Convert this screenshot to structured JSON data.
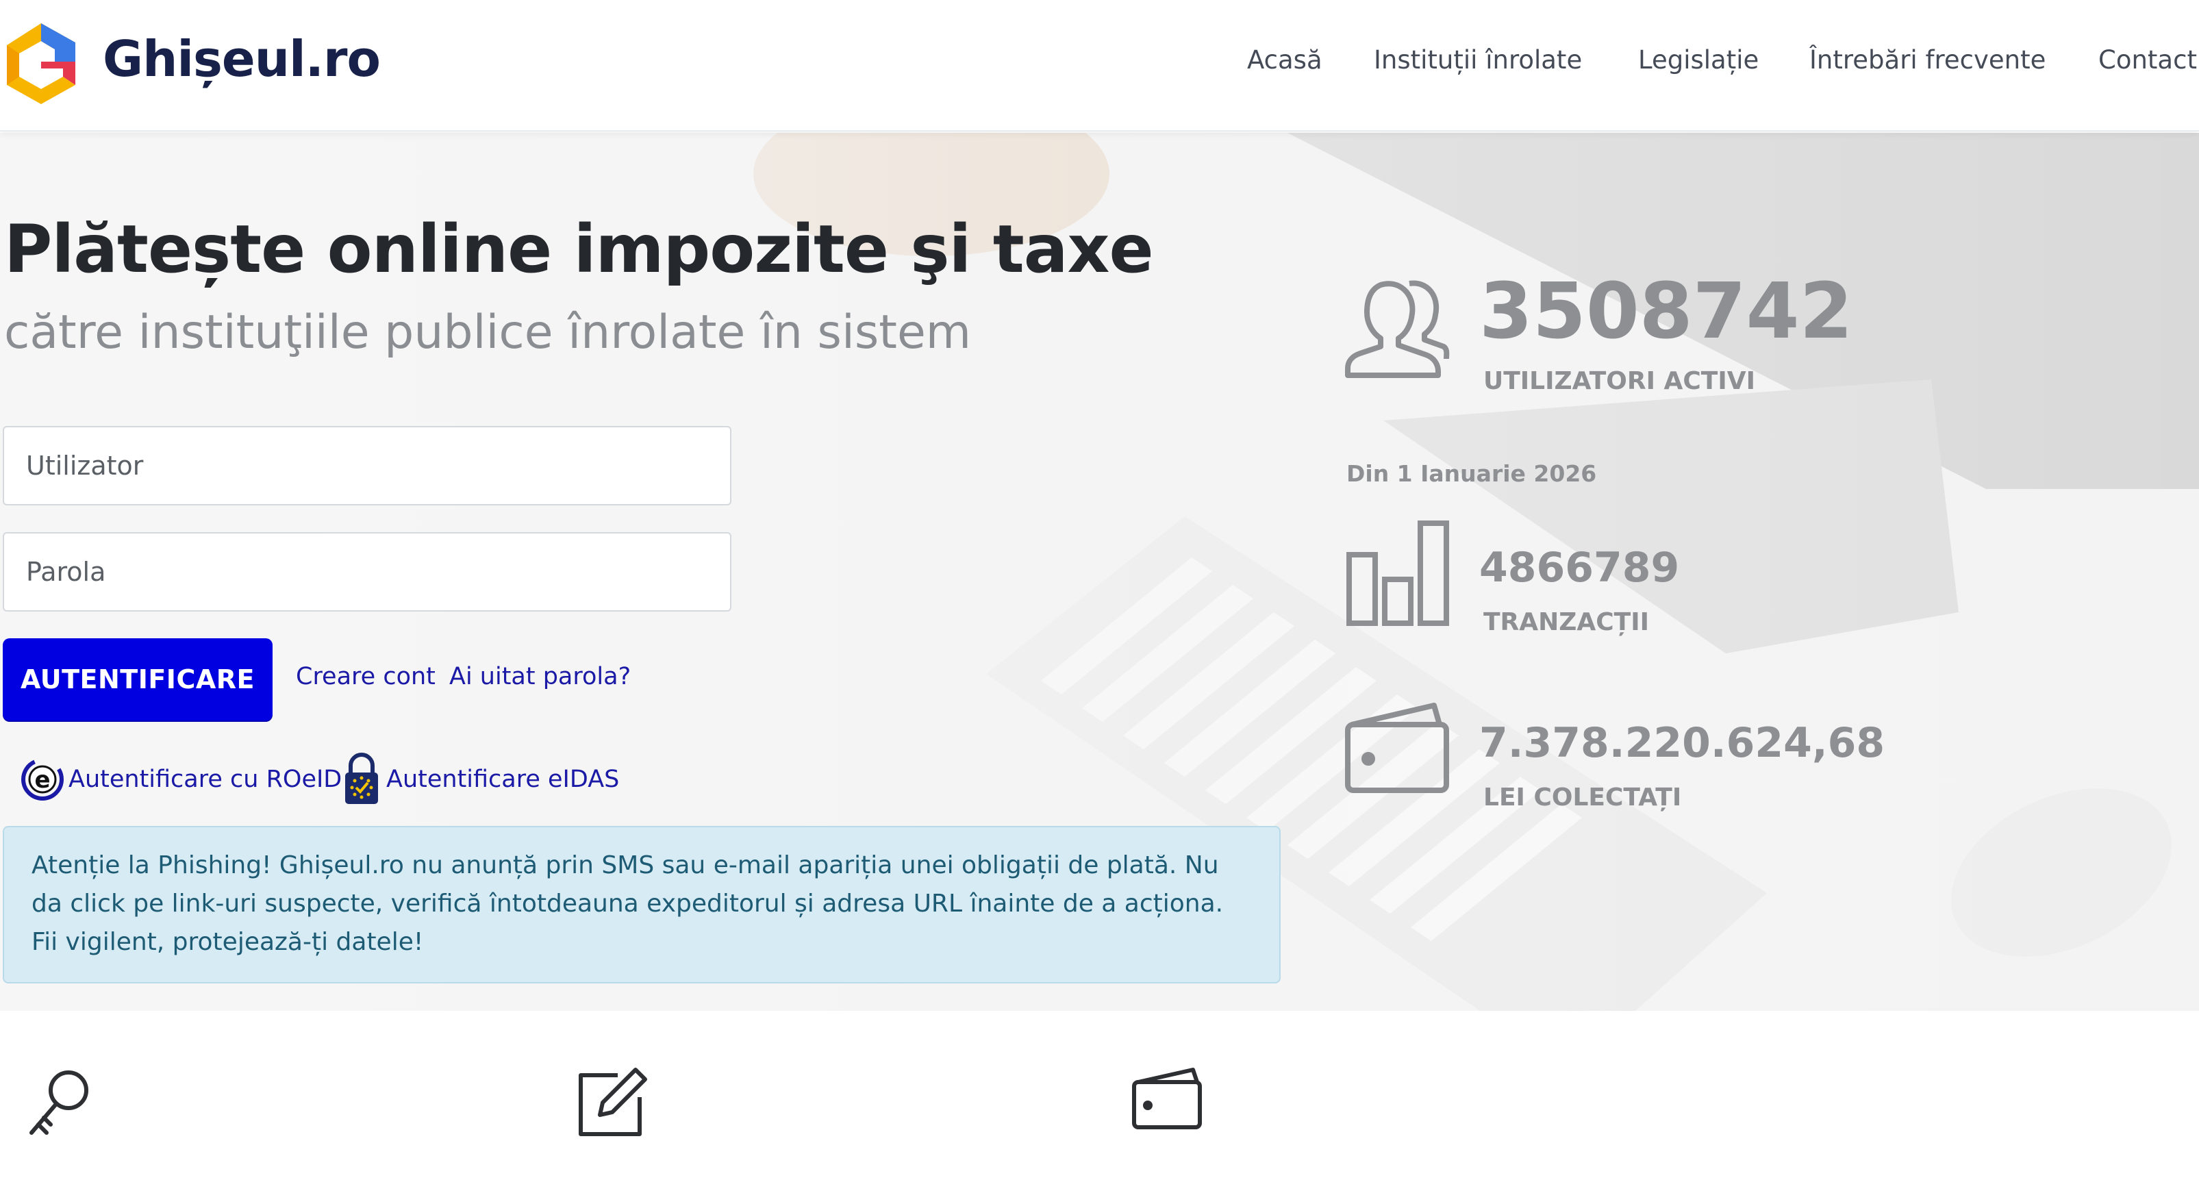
{
  "header": {
    "brand": "Ghișeul.ro",
    "nav": [
      {
        "label": "Acasă"
      },
      {
        "label": "Instituții înrolate"
      },
      {
        "label": "Legislație"
      },
      {
        "label": "Întrebări frecvente"
      },
      {
        "label": "Contact"
      }
    ]
  },
  "hero": {
    "title": "Plătește online impozite şi taxe",
    "subtitle": "către instituţiile publice înrolate în sistem"
  },
  "login": {
    "username_placeholder": "Utilizator",
    "username_value": "",
    "password_placeholder": "Parola",
    "password_value": "",
    "submit_label": "AUTENTIFICARE",
    "create_account": "Creare cont",
    "forgot_password": "Ai uitat parola?",
    "roeid_label": "Autentificare cu ROeID",
    "eidas_label": "Autentificare eIDAS"
  },
  "alert": {
    "text": "Atenție la Phishing! Ghișeul.ro nu anunță prin SMS sau e-mail apariția unei obligații de plată. Nu da click pe link-uri suspecte, verifică întotdeauna expeditorul și adresa URL înainte de a acționa. Fii vigilent, protejează-ți datele!"
  },
  "stats": {
    "users_value": "3508742",
    "users_label": "UTILIZATORI ACTIVI",
    "since": "Din 1 Ianuarie 2026",
    "transactions_value": "4866789",
    "transactions_label": "TRANZACȚII",
    "collected_value": "7.378.220.624,68",
    "collected_label": "LEI COLECTAȚI"
  },
  "colors": {
    "primary_button": "#0000e0",
    "link": "#1a1aa6",
    "alert_bg": "#d6ebf3",
    "alert_text": "#1d5a74",
    "stat_text": "#8d8f92"
  },
  "icons": {
    "users": "users-icon",
    "transactions": "bar-chart-icon",
    "collected": "wallet-icon",
    "feature_1": "key-icon",
    "feature_2": "edit-icon",
    "feature_3": "wallet-icon"
  }
}
